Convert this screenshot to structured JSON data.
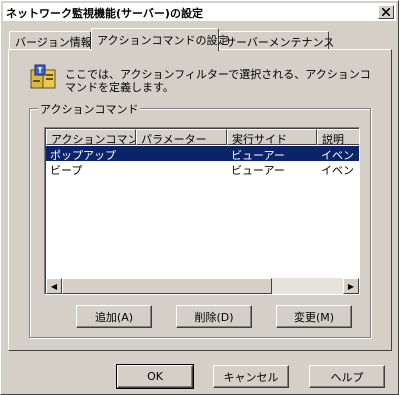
{
  "window": {
    "title": "ネットワーク監視機能(サーバー)の設定",
    "close_glyph": "✕"
  },
  "tabs": [
    {
      "label": "バージョン情報",
      "active": false
    },
    {
      "label": "アクションコマンドの設定",
      "active": true
    },
    {
      "label": "サーバーメンテナンス",
      "active": false
    }
  ],
  "panel": {
    "description": "ここでは、アクションフィルターで選択される、アクションコマンドを定義します。",
    "icon": "info-book-icon",
    "group_label": "アクションコマンド",
    "list": {
      "columns": [
        "アクションコマンド",
        "パラメーター",
        "実行サイド",
        "説明"
      ],
      "rows": [
        {
          "cells": [
            "ポップアップ",
            "",
            "ビューアー",
            "イベン"
          ],
          "selected": true
        },
        {
          "cells": [
            "ビープ",
            "",
            "ビューアー",
            "イベン"
          ],
          "selected": false
        }
      ],
      "scroll_left_glyph": "◀",
      "scroll_right_glyph": "▶"
    },
    "buttons": {
      "add": "追加(A)",
      "delete": "削除(D)",
      "modify": "変更(M)"
    }
  },
  "footer": {
    "ok": "OK",
    "cancel": "キャンセル",
    "help": "ヘルプ"
  },
  "colors": {
    "selection": "#0a246a",
    "face": "#d4d0c8"
  }
}
